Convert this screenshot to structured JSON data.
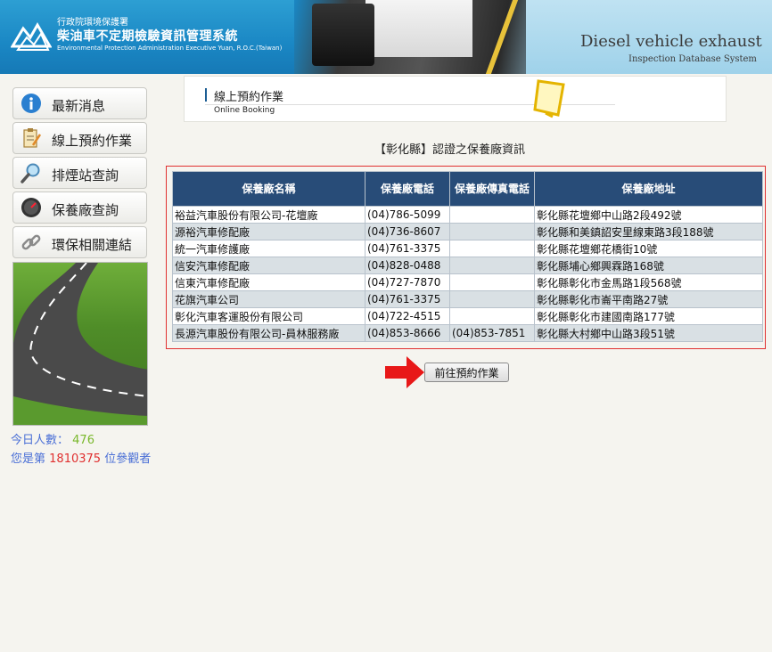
{
  "header": {
    "agency": "行政院環境保護署",
    "title": "柴油車不定期檢驗資訊管理系統",
    "subtitle_en": "Environmental Protection Administration Executive Yuan, R.O.C.(Taiwan)",
    "title_en": "Diesel vehicle exhaust",
    "subtitle_en_right": "Inspection Database System"
  },
  "sidebar": {
    "items": [
      {
        "label": "最新消息",
        "icon": "info-icon"
      },
      {
        "label": "線上預約作業",
        "icon": "clipboard-icon"
      },
      {
        "label": "排煙站查詢",
        "icon": "magnifier-icon"
      },
      {
        "label": "保養廠查詢",
        "icon": "gauge-icon"
      },
      {
        "label": "環保相關連結",
        "icon": "chain-link-icon"
      }
    ]
  },
  "counters": {
    "today_label": "今日人數：",
    "today_value": "476",
    "visitor_prefix": "您是第",
    "visitor_value": "1810375",
    "visitor_suffix": "位參觀者"
  },
  "section": {
    "title": "線上預約作業",
    "subtitle": "Online Booking"
  },
  "page_heading": "【彰化縣】認證之保養廠資訊",
  "table": {
    "headers": [
      "保養廠名稱",
      "保養廠電話",
      "保養廠傳真電話",
      "保養廠地址"
    ],
    "rows": [
      [
        "裕益汽車股份有限公司-花壇廠",
        "(04)786-5099",
        "",
        "彰化縣花壇鄉中山路2段492號"
      ],
      [
        "源裕汽車修配廠",
        "(04)736-8607",
        "",
        "彰化縣和美鎮詔安里線東路3段188號"
      ],
      [
        "統一汽車修護廠",
        "(04)761-3375",
        "",
        "彰化縣花壇鄉花橋街10號"
      ],
      [
        "信安汽車修配廠",
        "(04)828-0488",
        "",
        "彰化縣埔心鄉興霖路168號"
      ],
      [
        "信東汽車修配廠",
        "(04)727-7870",
        "",
        "彰化縣彰化市金馬路1段568號"
      ],
      [
        "花旗汽車公司",
        "(04)761-3375",
        "",
        "彰化縣彰化市崙平南路27號"
      ],
      [
        "彰化汽車客運股份有限公司",
        "(04)722-4515",
        "",
        "彰化縣彰化市建國南路177號"
      ],
      [
        "長源汽車股份有限公司-員林服務廠",
        "(04)853-8666",
        "(04)853-7851",
        "彰化縣大村鄉中山路3段51號"
      ]
    ]
  },
  "actions": {
    "goto_booking_label": "前往預約作業"
  },
  "colors": {
    "header_blue": "#1a87c4",
    "table_header": "#284c78",
    "row_alt": "#d9e0e4",
    "highlight_red": "#e03030",
    "counter_blue": "#4a6fd6"
  }
}
